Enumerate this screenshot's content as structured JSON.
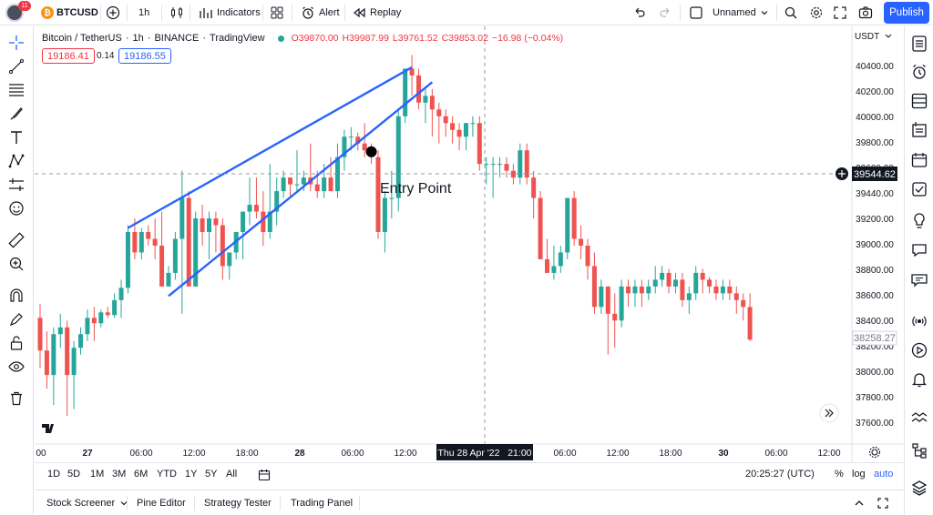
{
  "topbar": {
    "notifications": "11",
    "symbol": "BTCUSD",
    "interval": "1h",
    "indicators_label": "Indicators",
    "alert_label": "Alert",
    "replay_label": "Replay",
    "layout_name": "Unnamed",
    "publish_label": "Publish"
  },
  "legend": {
    "pair": "Bitcoin / TetherUS",
    "interval": "1h",
    "exchange": "BINANCE",
    "provider": "TradingView",
    "open": "O39870.00",
    "high": "H39987.99",
    "low": "L39761.52",
    "close": "C39853.02",
    "change": "−16.98 (−0.04%)",
    "sell_price": "19186.41",
    "spread": "0.14",
    "buy_price": "19186.55"
  },
  "price_axis": {
    "currency": "USDT",
    "ticks": [
      "40400.00",
      "40200.00",
      "40000.00",
      "39800.00",
      "39600.00",
      "39440.00",
      "39200.00",
      "39000.00",
      "38800.00",
      "38600.00",
      "38400.00",
      "38200.00",
      "38000.00",
      "37800.00",
      "37600.00"
    ],
    "crosshair_price": "39544.62",
    "last_price": "38258.27"
  },
  "time_axis": {
    "ticks": [
      "00",
      "27",
      "06:00",
      "12:00",
      "18:00",
      "28",
      "06:00",
      "12:00",
      "06:00",
      "12:00",
      "18:00",
      "30",
      "06:00",
      "12:00"
    ],
    "crosshair_time": "Thu 28 Apr '22   21:00"
  },
  "annotation": {
    "text": "Entry Point"
  },
  "ranges": [
    "1D",
    "5D",
    "1M",
    "3M",
    "6M",
    "YTD",
    "1Y",
    "5Y",
    "All"
  ],
  "clock": "20:25:27 (UTC)",
  "scale_options": [
    "%",
    "log",
    "auto"
  ],
  "bottom_tabs": [
    "Stock Screener",
    "Pine Editor",
    "Strategy Tester",
    "Trading Panel"
  ],
  "colors": {
    "up": "#26a69a",
    "down": "#ef5350",
    "trendline": "#2962ff",
    "accent": "#2962ff"
  },
  "chart_data": {
    "type": "candlestick",
    "ylim": [
      37500,
      40560
    ],
    "candles": [
      [
        38420,
        38520,
        38050,
        38180
      ],
      [
        38180,
        38320,
        37900,
        38000
      ],
      [
        38000,
        38350,
        37780,
        38300
      ],
      [
        38300,
        38450,
        38200,
        38350
      ],
      [
        38350,
        38400,
        37700,
        38000
      ],
      [
        38000,
        38250,
        37750,
        38200
      ],
      [
        38200,
        38350,
        38150,
        38300
      ],
      [
        38300,
        38480,
        38250,
        38420
      ],
      [
        38420,
        38500,
        38250,
        38380
      ],
      [
        38380,
        38480,
        38350,
        38460
      ],
      [
        38460,
        38500,
        38420,
        38440
      ],
      [
        38440,
        38600,
        38420,
        38550
      ],
      [
        38550,
        38700,
        38420,
        38640
      ],
      [
        38640,
        39100,
        38600,
        39050
      ],
      [
        39050,
        39150,
        38850,
        38900
      ],
      [
        38900,
        39080,
        38850,
        39050
      ],
      [
        39050,
        39100,
        38950,
        39000
      ],
      [
        39000,
        39150,
        38850,
        38950
      ],
      [
        38950,
        39200,
        38700,
        38650
      ],
      [
        38650,
        38800,
        38650,
        38750
      ],
      [
        38750,
        39050,
        38700,
        39000
      ],
      [
        39000,
        39500,
        38450,
        39300
      ],
      [
        39300,
        39350,
        38900,
        38650
      ],
      [
        38650,
        39200,
        38650,
        39150
      ],
      [
        39150,
        39250,
        38950,
        39050
      ],
      [
        39050,
        39200,
        38850,
        39150
      ],
      [
        39150,
        39200,
        38900,
        39100
      ],
      [
        39100,
        39150,
        38700,
        38800
      ],
      [
        38800,
        38900,
        38700,
        38900
      ],
      [
        38900,
        39050,
        38850,
        39050
      ],
      [
        39050,
        39200,
        38850,
        39200
      ],
      [
        39200,
        39450,
        39100,
        39250
      ],
      [
        39250,
        39450,
        39150,
        39200
      ],
      [
        39200,
        39350,
        38950,
        39050
      ],
      [
        39050,
        39550,
        39000,
        39200
      ],
      [
        39200,
        39450,
        39100,
        39350
      ],
      [
        39350,
        39500,
        39300,
        39450
      ],
      [
        39450,
        39450,
        39300,
        39400
      ],
      [
        39400,
        39650,
        39350,
        39400
      ],
      [
        39400,
        39500,
        39350,
        39450
      ],
      [
        39450,
        39700,
        39350,
        39400
      ],
      [
        39400,
        39500,
        39300,
        39350
      ],
      [
        39350,
        39550,
        39300,
        39450
      ],
      [
        39450,
        39600,
        39350,
        39350
      ],
      [
        39350,
        39700,
        39300,
        39600
      ],
      [
        39600,
        39800,
        39500,
        39750
      ],
      [
        39750,
        39820,
        39650,
        39750
      ],
      [
        39750,
        39780,
        39650,
        39700
      ],
      [
        39700,
        39850,
        39600,
        39650
      ],
      [
        39650,
        39700,
        39550,
        39600
      ],
      [
        39600,
        39650,
        39000,
        39050
      ],
      [
        39050,
        39350,
        38900,
        39300
      ],
      [
        39300,
        39500,
        39150,
        39300
      ],
      [
        39300,
        39950,
        39200,
        39900
      ],
      [
        39900,
        40250,
        39850,
        40250
      ],
      [
        40250,
        40350,
        40050,
        40200
      ],
      [
        40200,
        40250,
        39950,
        40000
      ],
      [
        40000,
        40100,
        39850,
        40050
      ],
      [
        40050,
        40100,
        39750,
        39950
      ],
      [
        39950,
        40000,
        39700,
        39900
      ],
      [
        39900,
        39950,
        39750,
        39850
      ],
      [
        39850,
        39900,
        39700,
        39800
      ],
      [
        39800,
        39850,
        39650,
        39750
      ],
      [
        39750,
        39850,
        39650,
        39850
      ],
      [
        39850,
        39900,
        39750,
        39850
      ],
      [
        39850,
        39900,
        39500,
        39550
      ],
      [
        39550,
        39600,
        39400,
        39550
      ],
      [
        39550,
        39600,
        39300,
        39550
      ],
      [
        39550,
        39600,
        39450,
        39550
      ],
      [
        39550,
        39600,
        39450,
        39500
      ],
      [
        39500,
        39550,
        39400,
        39450
      ],
      [
        39450,
        39700,
        39400,
        39650
      ],
      [
        39650,
        39700,
        39400,
        39450
      ],
      [
        39450,
        39500,
        39150,
        39300
      ],
      [
        39300,
        39350,
        38900,
        38850
      ],
      [
        38850,
        39000,
        38750,
        38750
      ],
      [
        38750,
        38950,
        38700,
        38800
      ],
      [
        38800,
        38950,
        38750,
        38900
      ],
      [
        38900,
        39300,
        38850,
        39300
      ],
      [
        39300,
        39350,
        38950,
        39000
      ],
      [
        39000,
        39100,
        38850,
        38950
      ],
      [
        38950,
        39000,
        38700,
        38800
      ],
      [
        38800,
        38900,
        38450,
        38500
      ],
      [
        38500,
        38700,
        38450,
        38650
      ],
      [
        38650,
        38650,
        38150,
        38450
      ],
      [
        38450,
        38600,
        38200,
        38400
      ],
      [
        38400,
        38700,
        38350,
        38650
      ],
      [
        38650,
        38700,
        38500,
        38600
      ],
      [
        38600,
        38700,
        38500,
        38650
      ],
      [
        38650,
        38700,
        38500,
        38600
      ],
      [
        38600,
        38700,
        38550,
        38650
      ],
      [
        38650,
        38800,
        38600,
        38700
      ],
      [
        38700,
        38800,
        38650,
        38750
      ],
      [
        38750,
        38780,
        38600,
        38650
      ],
      [
        38650,
        38750,
        38600,
        38700
      ],
      [
        38700,
        38750,
        38500,
        38550
      ],
      [
        38550,
        38650,
        38450,
        38600
      ],
      [
        38600,
        38800,
        38550,
        38750
      ],
      [
        38750,
        38780,
        38600,
        38700
      ],
      [
        38700,
        38720,
        38600,
        38650
      ],
      [
        38650,
        38700,
        38550,
        38600
      ],
      [
        38600,
        38700,
        38550,
        38650
      ],
      [
        38650,
        38700,
        38550,
        38600
      ],
      [
        38600,
        38650,
        38450,
        38550
      ],
      [
        38550,
        38600,
        38400,
        38500
      ],
      [
        38500,
        38600,
        38250,
        38260
      ]
    ],
    "trendlines": [
      {
        "from": [
          13,
          39080
        ],
        "to": [
          55,
          40260
        ]
      },
      {
        "from": [
          19,
          38580
        ],
        "to": [
          58,
          40150
        ]
      }
    ],
    "annotation": {
      "index": 49,
      "price": 39640
    }
  }
}
